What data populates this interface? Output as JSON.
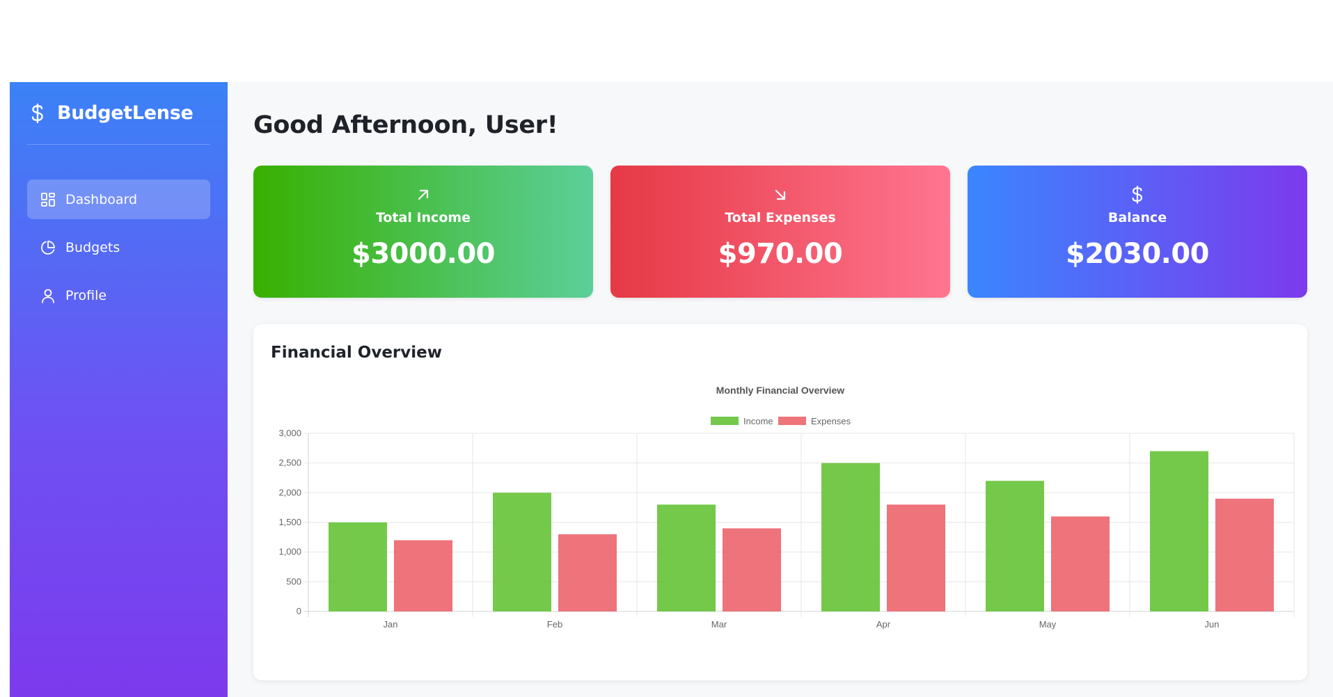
{
  "brand": {
    "name": "BudgetLense",
    "icon": "dollar-icon"
  },
  "nav": [
    {
      "label": "Dashboard",
      "icon": "dashboard-grid-icon",
      "active": true
    },
    {
      "label": "Budgets",
      "icon": "pie-chart-icon",
      "active": false
    },
    {
      "label": "Profile",
      "icon": "user-icon",
      "active": false
    }
  ],
  "greeting": "Good Afternoon, User!",
  "cards": {
    "income": {
      "label": "Total Income",
      "value": "$3000.00",
      "icon": "arrow-up-right-icon",
      "colors": [
        "#38b000",
        "#5ccf9a"
      ]
    },
    "expenses": {
      "label": "Total Expenses",
      "value": "$970.00",
      "icon": "arrow-down-right-icon",
      "colors": [
        "#e63946",
        "#ff758f"
      ]
    },
    "balance": {
      "label": "Balance",
      "value": "$2030.00",
      "icon": "dollar-icon",
      "colors": [
        "#3a86ff",
        "#7c3aed"
      ]
    }
  },
  "panel": {
    "title": "Financial Overview"
  },
  "chart_data": {
    "type": "bar",
    "title": "Monthly Financial Overview",
    "categories": [
      "Jan",
      "Feb",
      "Mar",
      "Apr",
      "May",
      "Jun"
    ],
    "series": [
      {
        "name": "Income",
        "values": [
          1500,
          2000,
          1800,
          2500,
          2200,
          2700
        ],
        "color": "#5cbf2a"
      },
      {
        "name": "Expenses",
        "values": [
          1200,
          1300,
          1400,
          1800,
          1600,
          1900
        ],
        "color": "#eb5a64"
      }
    ],
    "ylim": [
      0,
      3000
    ],
    "yticks": [
      "0",
      "500",
      "1,000",
      "1,500",
      "2,000",
      "2,500",
      "3,000"
    ],
    "yvalues": [
      0,
      500,
      1000,
      1500,
      2000,
      2500,
      3000
    ],
    "grid": true,
    "legend": "top"
  }
}
